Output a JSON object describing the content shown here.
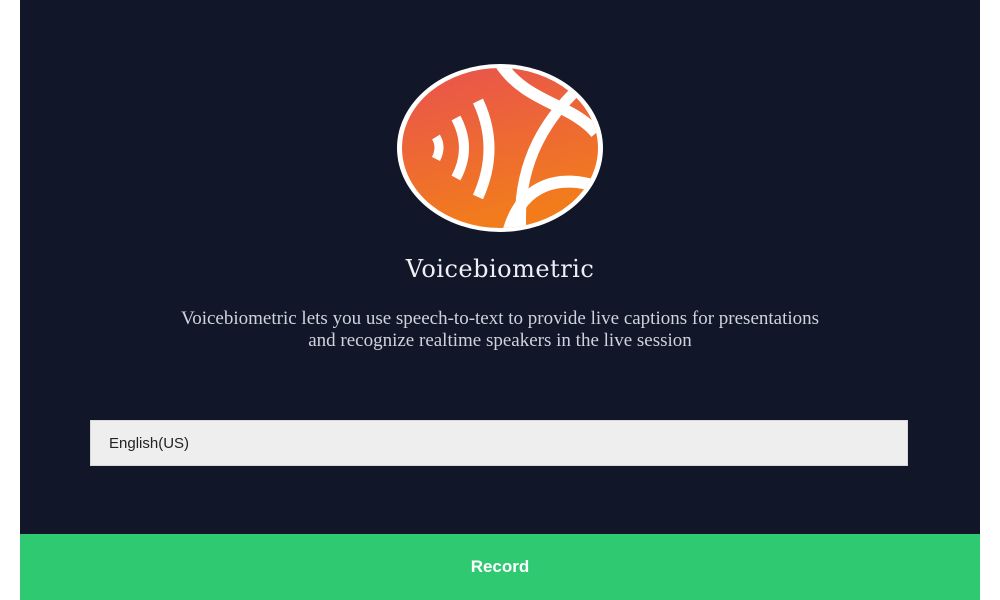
{
  "app": {
    "title": "Voicebiometric",
    "description_line1": "Voicebiometric lets you use speech-to-text to provide live captions for presentations",
    "description_line2": "and recognize realtime speakers in the live session"
  },
  "language_select": {
    "selected": "English(US)"
  },
  "record": {
    "label": "Record"
  },
  "logo": {
    "icon": "voicebiometric-logo",
    "colors": {
      "gradient_top": "#e8544e",
      "gradient_bottom": "#f07a1e",
      "ring": "#ffffff"
    }
  },
  "colors": {
    "background": "#111729",
    "accent": "#2ec971"
  }
}
